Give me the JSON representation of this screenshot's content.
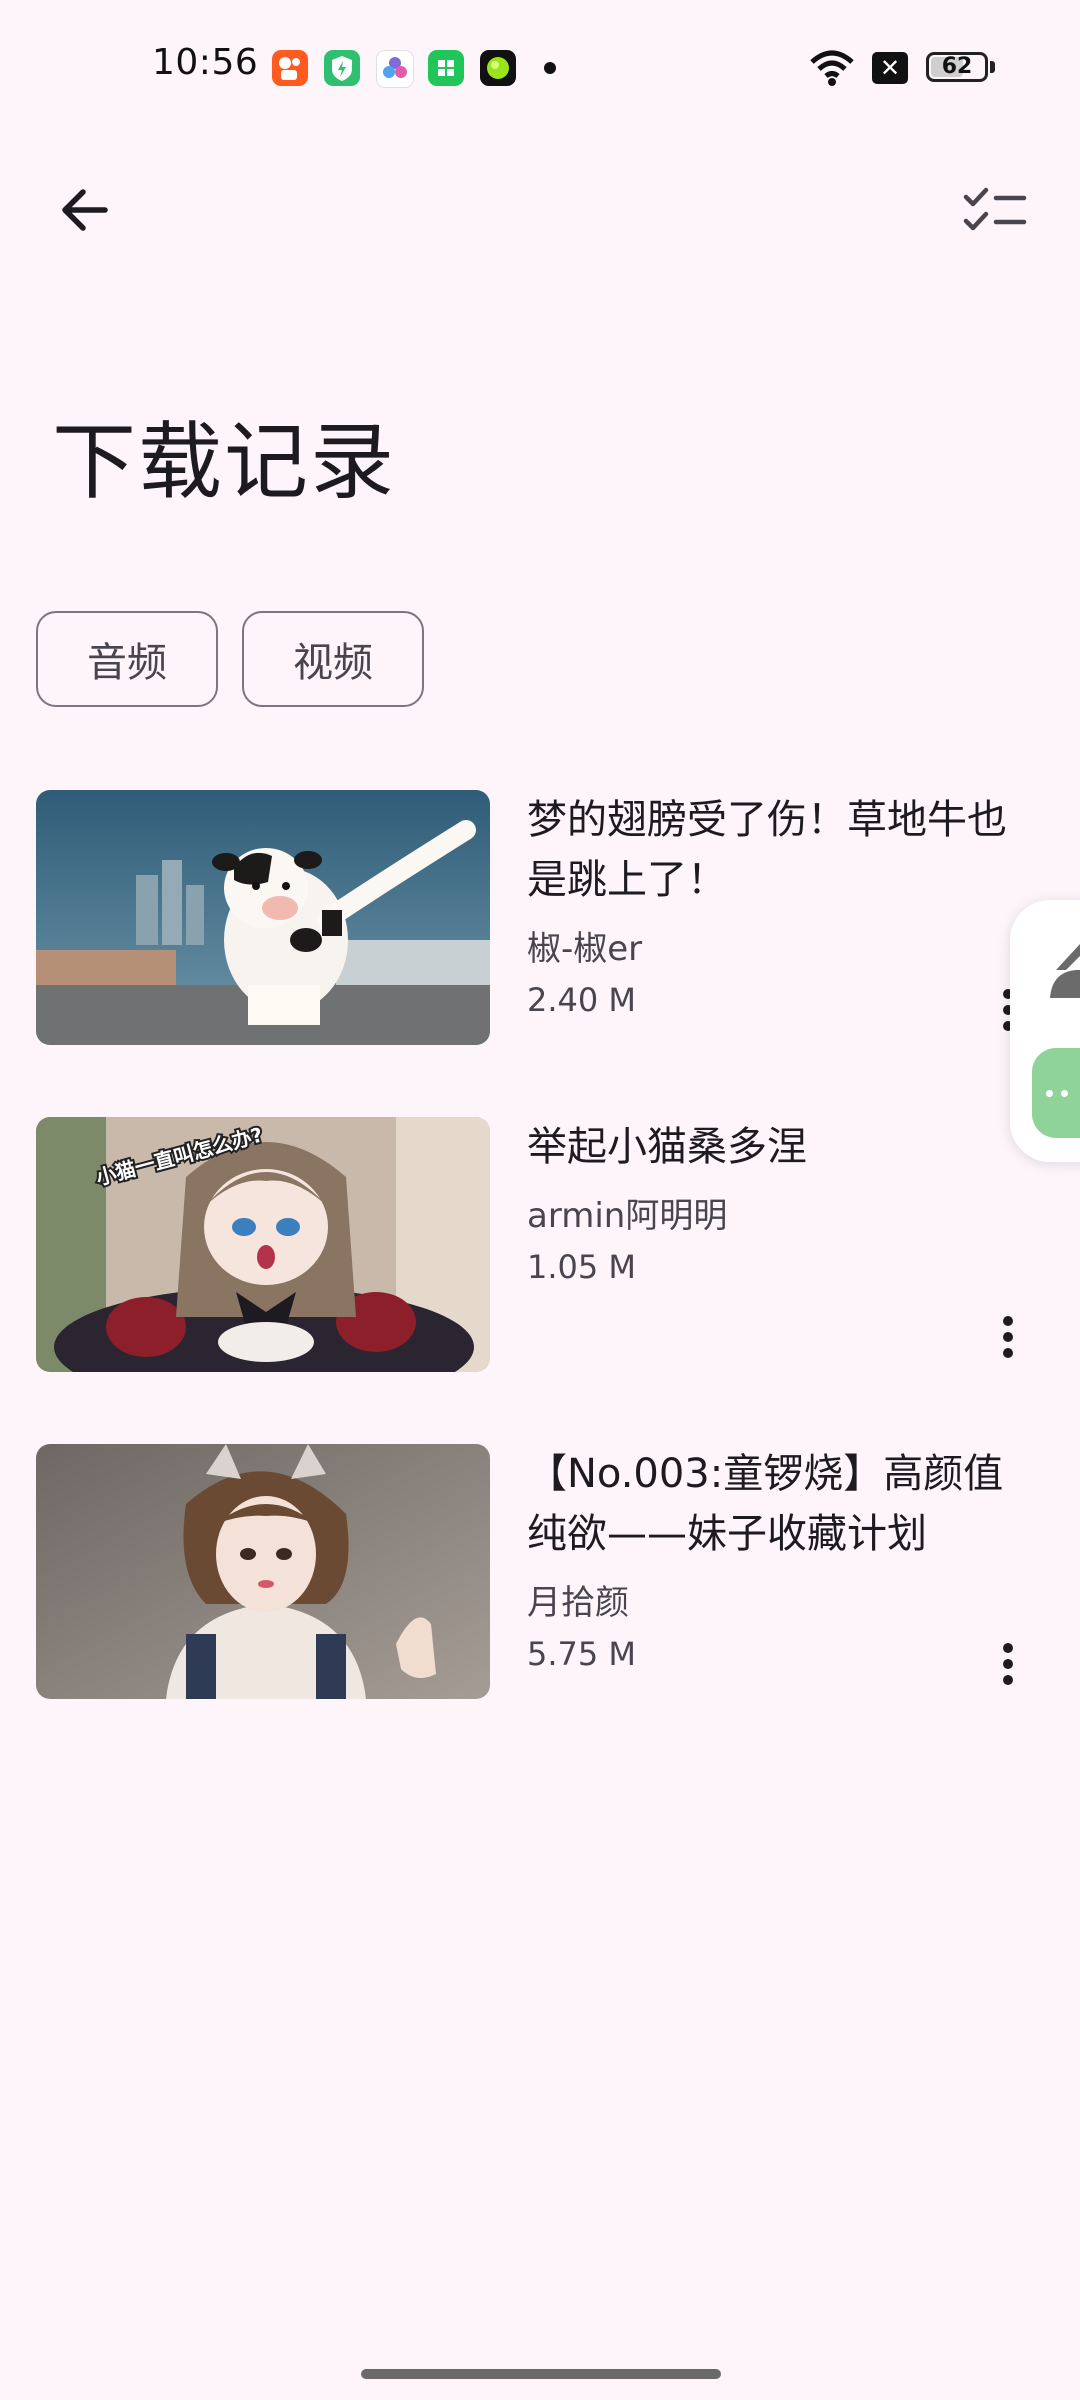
{
  "status_bar": {
    "time": "10:56",
    "battery": "62",
    "battery_level": 0.62,
    "notification_icons": [
      "kuaishou-icon",
      "shield-icon",
      "gameflow-icon",
      "green-app-icon",
      "ball-app-icon"
    ]
  },
  "app_bar": {
    "back_icon": "arrow-back-icon",
    "action_icon": "checklist-icon"
  },
  "page": {
    "title": "下载记录"
  },
  "filters": [
    {
      "label": "音频"
    },
    {
      "label": "视频"
    }
  ],
  "downloads": [
    {
      "title": "梦的翅膀受了伤！草地牛也是跳上了！",
      "author": "椒-椒er",
      "size": "2.40 M",
      "thumbnail": "cow-cartoon"
    },
    {
      "title": "举起小猫桑多涅",
      "author": "armin阿明明",
      "size": "1.05 M",
      "thumbnail": "anime-girl",
      "thumbnail_caption": "小猫一直叫怎么办?"
    },
    {
      "title": "【No.003:童锣烧】高颜值 纯欲——妹子收藏计划",
      "author": "月拾颜",
      "size": "5.75 M",
      "thumbnail": "cosplay-girl"
    }
  ],
  "colors": {
    "background": "#fdf5fa",
    "accent_green": "#8fd39a",
    "chip_border": "#7a757f"
  }
}
